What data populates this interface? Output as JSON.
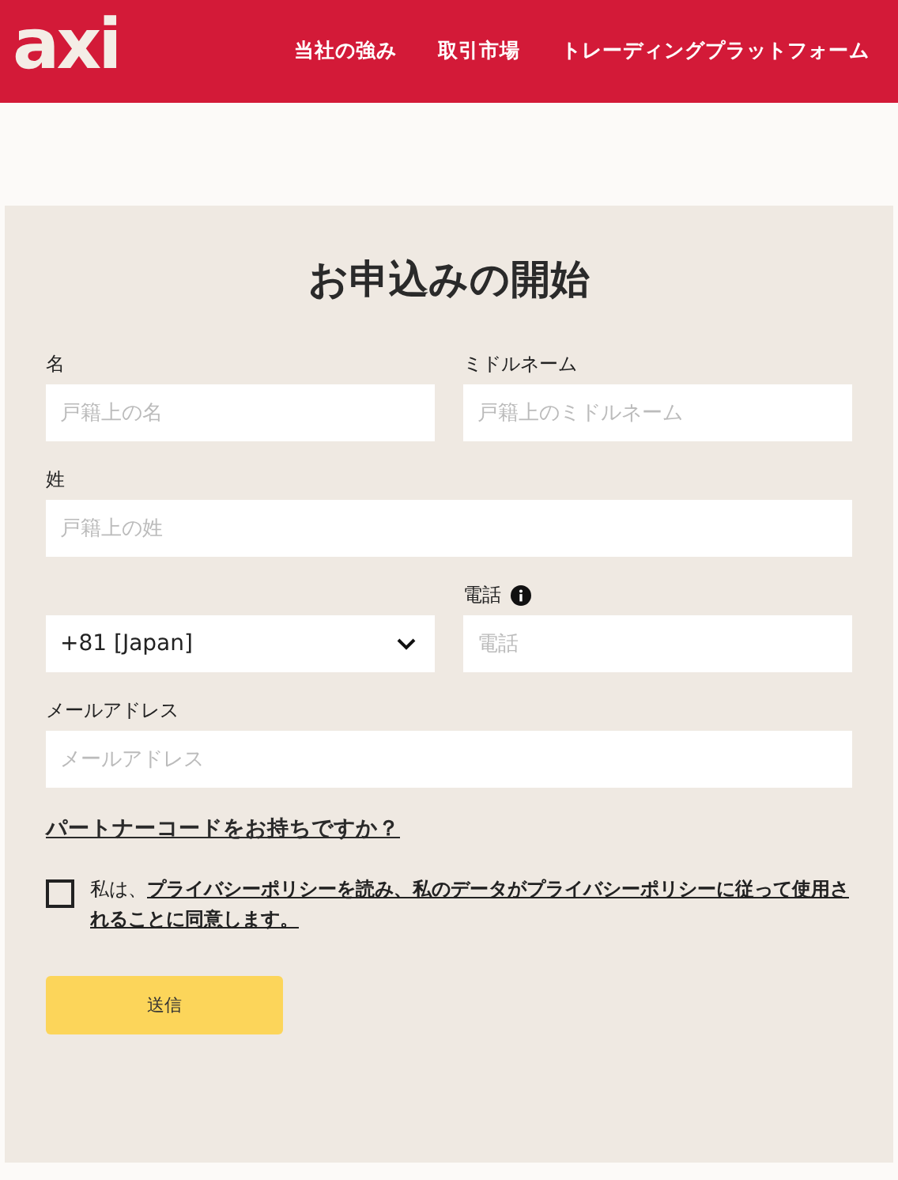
{
  "header": {
    "logo": "axi",
    "nav": [
      "当社の強み",
      "取引市場",
      "トレーディングプラットフォーム"
    ]
  },
  "form": {
    "title": "お申込みの開始",
    "rows": [
      [
        {
          "kind": "text",
          "label": "名",
          "placeholder": "戸籍上の名"
        },
        {
          "kind": "text",
          "label": "ミドルネーム",
          "placeholder": "戸籍上のミドルネーム"
        }
      ],
      [
        {
          "kind": "text",
          "label": "姓",
          "placeholder": "戸籍上の姓"
        }
      ],
      [
        {
          "kind": "select",
          "value": "+81 [Japan]"
        },
        {
          "kind": "text",
          "label": "電話",
          "info": true,
          "placeholder": "電話"
        }
      ],
      [
        {
          "kind": "text",
          "label": "メールアドレス",
          "placeholder": "メールアドレス"
        }
      ]
    ],
    "partner_link": "パートナーコードをお持ちですか？",
    "consent": {
      "checked": false,
      "text": "私は、**プライバシーポリシーを読み、私のデータがプライバシーポリシーに従って使用されることに同意します。**"
    },
    "submit": "送信"
  }
}
